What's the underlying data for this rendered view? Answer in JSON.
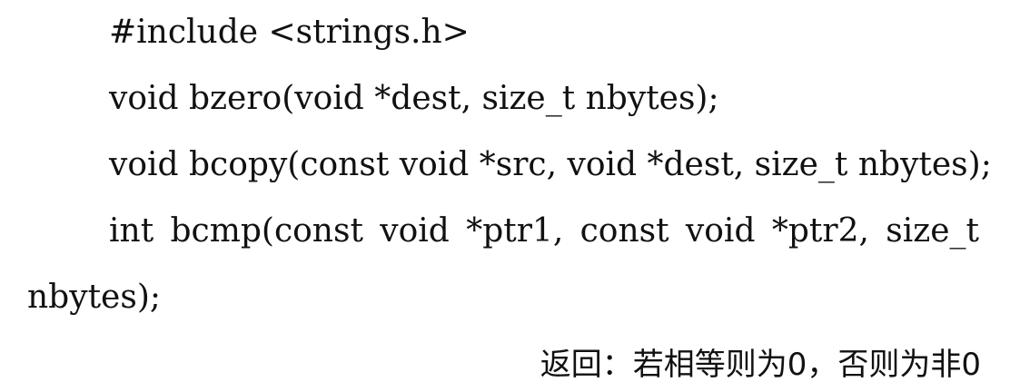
{
  "lines": {
    "include": "#include <strings.h>",
    "bzero": "void bzero(void *dest, size_t nbytes);",
    "bcopy": "void bcopy(const void *src, void *dest, size_t nbytes);",
    "bcmp_words": [
      "int",
      "bcmp(const",
      "void",
      "*ptr1,",
      "const",
      "void",
      "*ptr2,",
      "size_t"
    ],
    "bcmp_cont": "nbytes);",
    "note": "返回：若相等则为0，否则为非0"
  }
}
